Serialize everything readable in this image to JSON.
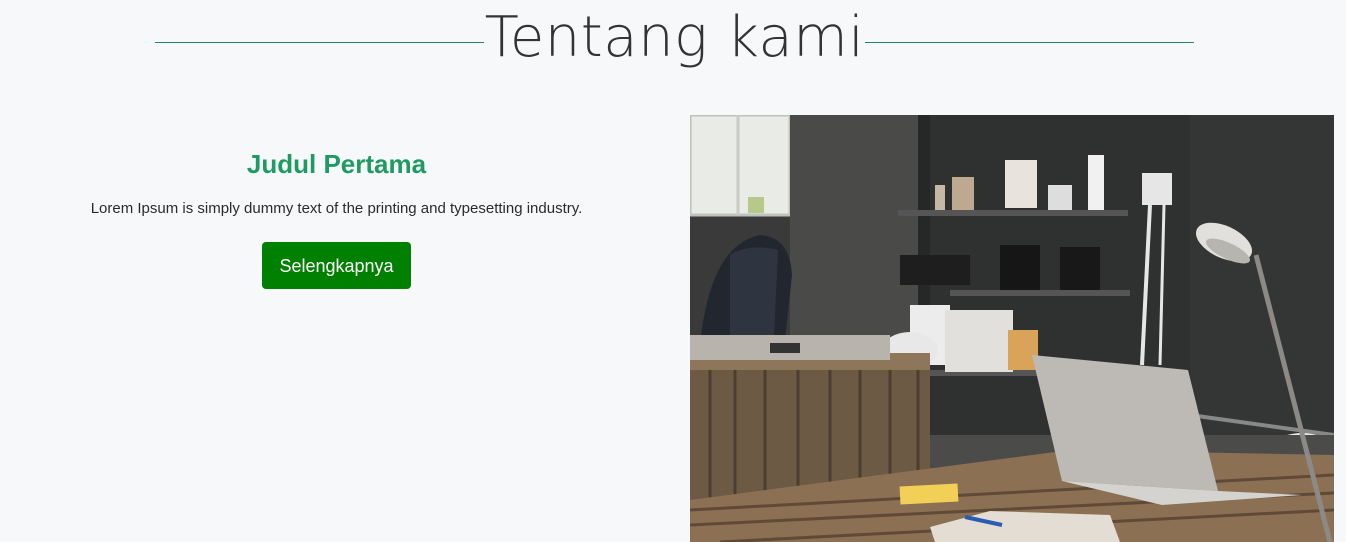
{
  "section": {
    "title": "Tentang kami"
  },
  "about": {
    "heading": "Judul Pertama",
    "text": "Lorem Ipsum is simply dummy text of the printing and typesetting industry.",
    "button_label": "Selengkapnya"
  },
  "colors": {
    "accent_green": "#1f9a63",
    "button_green": "#008000",
    "background": "#f7f8fa"
  }
}
